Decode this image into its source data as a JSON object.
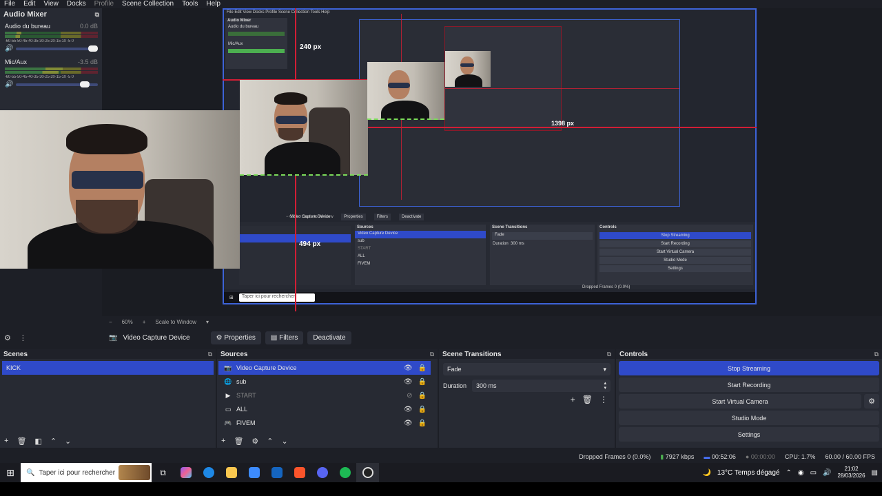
{
  "menu": [
    "File",
    "Edit",
    "View",
    "Docks",
    "Profile",
    "Scene Collection",
    "Tools",
    "Help"
  ],
  "audio_mixer": {
    "title": "Audio Mixer",
    "ticks": "-60-55-50-45-40-35-30-25-20-15-10 -5 0",
    "channels": [
      {
        "name": "Audio du bureau",
        "db": "0.0 dB"
      },
      {
        "name": "Mic/Aux",
        "db": "-3.5 dB"
      }
    ]
  },
  "preview": {
    "labels": {
      "px240": "240 px",
      "px1398": "1398 px",
      "px494": "494 px"
    },
    "zoom": {
      "minus": "−",
      "value": "60%",
      "plus": "+",
      "mode": "Scale to Window"
    }
  },
  "source_toolbar": {
    "source_name": "Video Capture Device",
    "buttons": {
      "properties": "Properties",
      "filters": "Filters",
      "deactivate": "Deactivate"
    }
  },
  "scenes": {
    "title": "Scenes",
    "items": [
      "KICK"
    ]
  },
  "sources": {
    "title": "Sources",
    "items": [
      {
        "name": "Video Capture Device",
        "selected": true
      },
      {
        "name": "sub"
      },
      {
        "name": "START",
        "hidden": true
      },
      {
        "name": "ALL"
      },
      {
        "name": "FIVEM"
      }
    ]
  },
  "transitions": {
    "title": "Scene Transitions",
    "selected": "Fade",
    "duration_label": "Duration",
    "duration_value": "300 ms"
  },
  "controls": {
    "title": "Controls",
    "stop_streaming": "Stop Streaming",
    "start_recording": "Start Recording",
    "start_virtual_camera": "Start Virtual Camera",
    "studio_mode": "Studio Mode",
    "settings": "Settings"
  },
  "status": {
    "dropped": "Dropped Frames 0 (0.0%)",
    "kbps": "7927 kbps",
    "stream_time": "00:52:06",
    "rec_time": "00:00:00",
    "cpu": "CPU: 1.7%",
    "fps": "60.00 / 60.00 FPS"
  },
  "taskbar": {
    "search": "Taper ici pour rechercher",
    "weather": "13°C  Temps dégagé",
    "time": "21:02",
    "date": "28/03/2026"
  },
  "nested": {
    "menu": "File  Edit  View  Docks  Profile  Scene Collection  Tools  Help",
    "mixer_title": "Audio Mixer",
    "ch1": "Audio du bureau",
    "ch2": "Mic/Aux",
    "vcd": "Video Capture Device",
    "properties": "Properties",
    "filters": "Filters",
    "deactivate": "Deactivate",
    "sources_title": "Sources",
    "transitions_title": "Scene Transitions",
    "controls_title": "Controls",
    "fade": "Fade",
    "duration": "Duration",
    "duration_val": "300 ms",
    "zoom": "−   60%   +   Scale to Window",
    "dropped": "Dropped Frames 0 (0.0%)",
    "search": "Taper ici pour rechercher"
  },
  "colors": {
    "accent": "#2f4ac9",
    "guide": "#d21e35",
    "selection": "#7cdc5a",
    "panel": "#272a33",
    "background": "#1d1f26"
  }
}
